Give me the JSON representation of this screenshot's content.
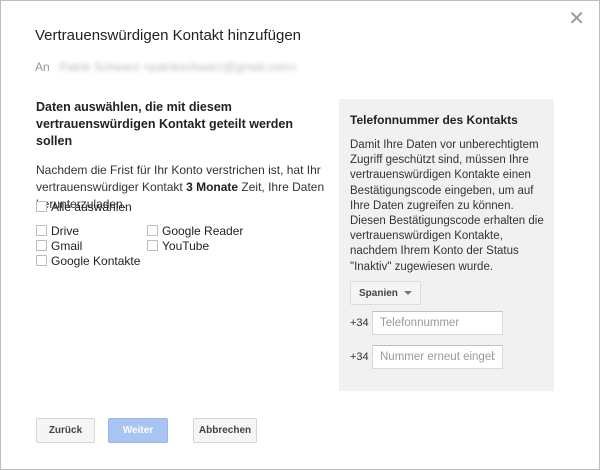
{
  "dialog": {
    "title": "Vertrauenswürdigen Kontakt hinzufügen",
    "to_label": "An",
    "to_value": "Patrik Schwarz <patrikschwarz@gmail.com>"
  },
  "left": {
    "section_title": "Daten auswählen, die mit diesem vertrauenswürdigen Kontakt geteilt werden sollen",
    "desc_part1": "Nachdem die Frist für Ihr Konto verstrichen ist, hat Ihr vertrauenswürdiger Kontakt ",
    "desc_bold": "3 Monate",
    "desc_part2": " Zeit, Ihre Daten herunterzuladen.",
    "select_all": "Alle auswählen",
    "services": [
      "Drive",
      "Gmail",
      "Google Kontakte",
      "Google Reader",
      "YouTube"
    ]
  },
  "panel": {
    "title": "Telefonnummer des Kontakts",
    "text": "Damit Ihre Daten vor unberechtigtem Zugriff geschützt sind, müssen Ihre vertrauenswürdigen Kontakte einen Bestätigungscode eingeben, um auf Ihre Daten zugreifen zu können. Diesen Bestätigungscode erhalten die vertrauenswürdigen Kontakte, nachdem Ihrem Konto der Status \"Inaktiv\" zugewiesen wurde.",
    "country": "Spanien",
    "dial_code_1": "+34",
    "phone_placeholder": "Telefonnummer",
    "dial_code_2": "+34",
    "phone_repeat_placeholder": "Nummer erneut eingeben"
  },
  "buttons": {
    "back": "Zurück",
    "next": "Weiter",
    "cancel": "Abbrechen"
  },
  "icons": {
    "close": "close-icon"
  }
}
